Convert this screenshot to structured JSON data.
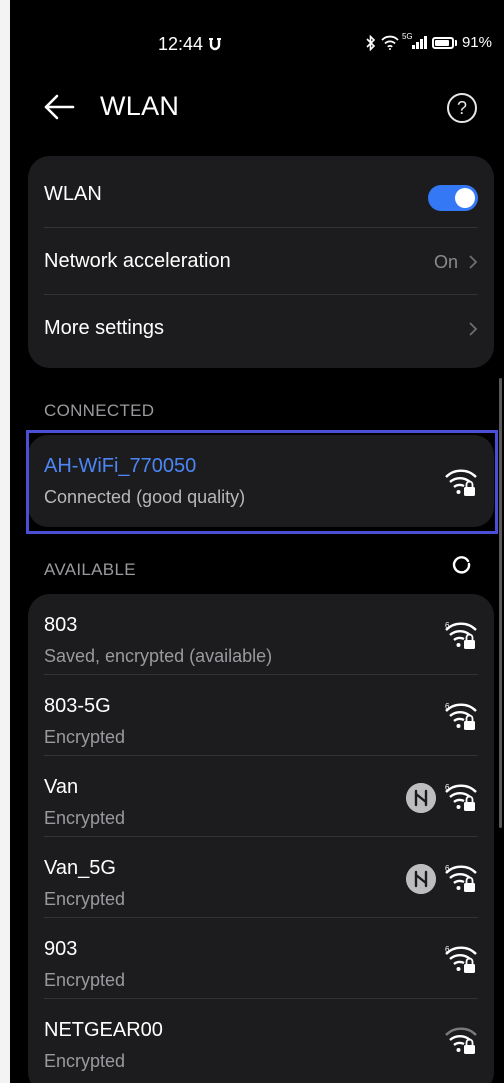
{
  "status_bar": {
    "time": "12:44",
    "network_type": "5G",
    "battery_percent": "91%"
  },
  "header": {
    "title": "WLAN",
    "help_symbol": "?"
  },
  "settings": [
    {
      "label": "WLAN",
      "control": "toggle",
      "enabled": true
    },
    {
      "label": "Network acceleration",
      "value": "On",
      "control": "chevron"
    },
    {
      "label": "More settings",
      "value": "",
      "control": "chevron"
    }
  ],
  "connected": {
    "section_label": "CONNECTED",
    "network": {
      "name": "AH-WiFi_770050",
      "status": "Connected (good quality)"
    }
  },
  "available": {
    "section_label": "AVAILABLE",
    "networks": [
      {
        "name": "803",
        "status": "Saved, encrypted (available)",
        "badge": "6",
        "hilink": false
      },
      {
        "name": "803-5G",
        "status": "Encrypted",
        "badge": "6",
        "hilink": false
      },
      {
        "name": "Van",
        "status": "Encrypted",
        "badge": "6",
        "hilink": true
      },
      {
        "name": "Van_5G",
        "status": "Encrypted",
        "badge": "6",
        "hilink": true
      },
      {
        "name": "903",
        "status": "Encrypted",
        "badge": "6",
        "hilink": false
      },
      {
        "name": "NETGEAR00",
        "status": "Encrypted",
        "badge": "",
        "hilink": false
      }
    ]
  },
  "colors": {
    "accent": "#3478f6",
    "connected_name": "#4c86f5",
    "card": "#1c1c1e",
    "highlight_border": "#4a4fd6"
  }
}
